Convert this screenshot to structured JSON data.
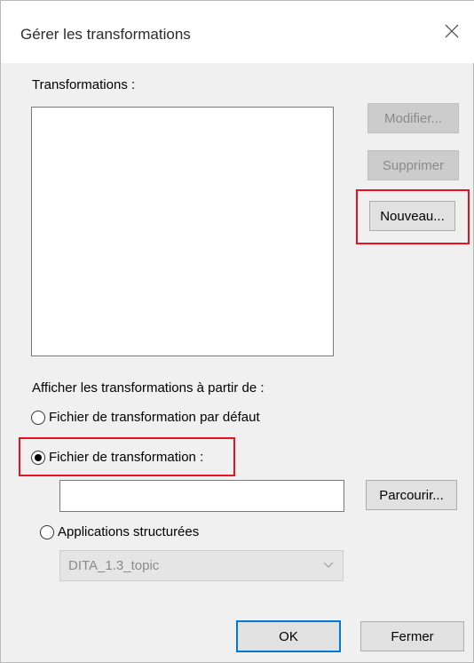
{
  "dialog": {
    "title": "Gérer les transformations",
    "close_icon": "close-icon"
  },
  "transformations": {
    "label": "Transformations :",
    "items": []
  },
  "buttons": {
    "modifier": "Modifier...",
    "supprimer": "Supprimer",
    "nouveau": "Nouveau...",
    "parcourir": "Parcourir...",
    "ok": "OK",
    "fermer": "Fermer"
  },
  "source": {
    "label": "Afficher les transformations à partir de :",
    "options": [
      {
        "label": "Fichier de transformation par défaut",
        "checked": false
      },
      {
        "label": "Fichier de transformation :",
        "checked": true
      },
      {
        "label": "Applications structurées",
        "checked": false
      }
    ],
    "file_path_value": "",
    "structured_app_selected": "DITA_1.3_topic"
  },
  "colors": {
    "highlight": "#e81123",
    "ok_focus": "#0078d7"
  }
}
